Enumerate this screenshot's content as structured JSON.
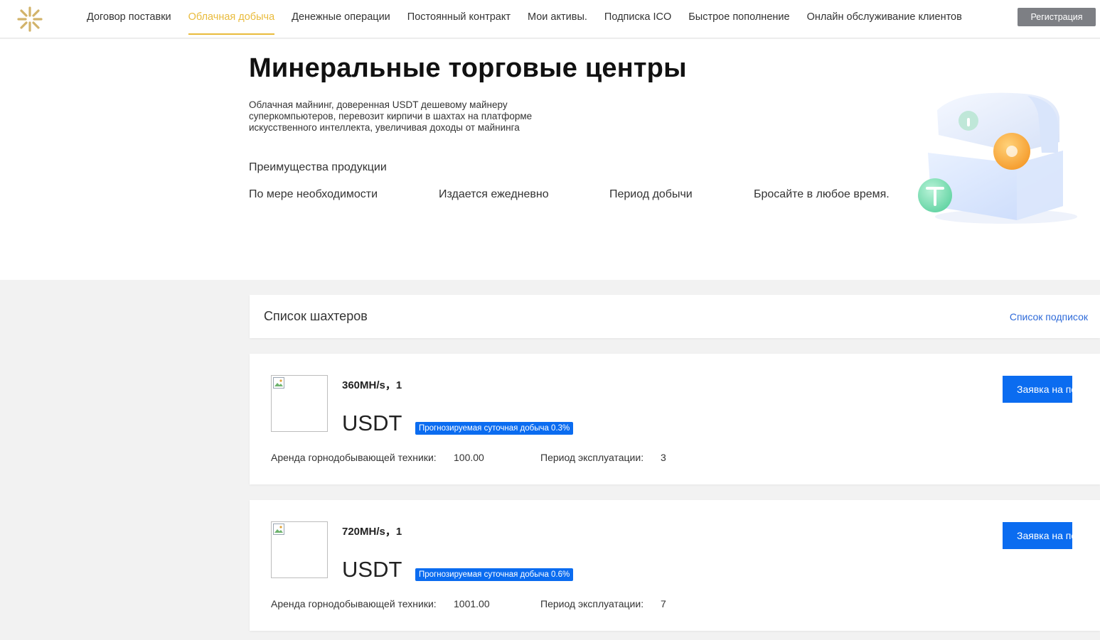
{
  "header": {
    "nav": [
      {
        "label": "Договор поставки",
        "active": false
      },
      {
        "label": "Облачная добыча",
        "active": true
      },
      {
        "label": "Денежные операции",
        "active": false
      },
      {
        "label": "Постоянный контракт",
        "active": false
      },
      {
        "label": "Мои активы.",
        "active": false
      },
      {
        "label": "Подписка ICO",
        "active": false
      },
      {
        "label": "Быстрое пополнение",
        "active": false
      },
      {
        "label": "Онлайн обслуживание клиентов",
        "active": false
      }
    ],
    "register_label": "Регистрация",
    "accent_color": "#e9bb3c"
  },
  "hero": {
    "title": "Минеральные торговые центры",
    "description": "Облачная майнинг, доверенная USDT дешевому майнеру суперкомпьютеров, перевозит кирпичи в шахтах на платформе искусственного интеллекта, увеличивая доходы от майнинга",
    "advantages_title": "Преимущества продукции",
    "advantages": [
      "По мере необходимости",
      "Издается ежедневно",
      "Период добычи",
      "Бросайте в любое время."
    ]
  },
  "list": {
    "title": "Список шахтеров",
    "subscriptions_link": "Список подписок"
  },
  "miners": [
    {
      "name": "360MH/s，1",
      "currency": "USDT",
      "badge": "Прогнозируемая суточная добыча 0.3%",
      "rent_label": "Аренда горнодобывающей техники:",
      "rent_value": "100.00",
      "period_label": "Период эксплуатации:",
      "period_value": "3",
      "apply_label": "Заявка на покупку"
    },
    {
      "name": "720MH/s，1",
      "currency": "USDT",
      "badge": "Прогнозируемая суточная добыча 0.6%",
      "rent_label": "Аренда горнодобывающей техники:",
      "rent_value": "1001.00",
      "period_label": "Период эксплуатации:",
      "period_value": "7",
      "apply_label": "Заявка на покупку"
    }
  ],
  "colors": {
    "primary_blue": "#0b6cf0",
    "link_blue": "#2f6bd9",
    "register_gray": "#7d7f84"
  }
}
